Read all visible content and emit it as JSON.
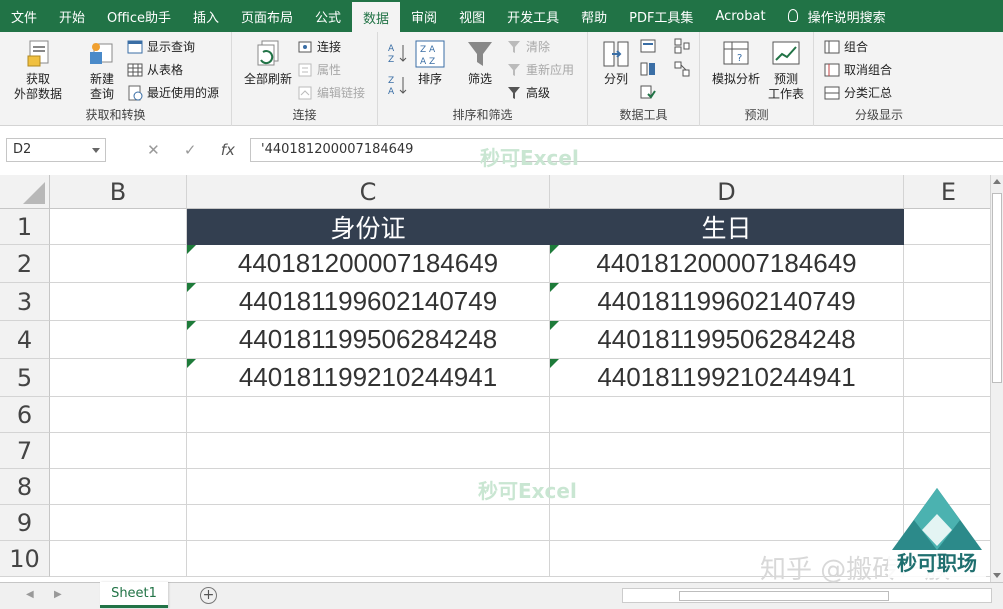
{
  "menu": {
    "tabs": [
      "文件",
      "开始",
      "Office助手",
      "插入",
      "页面布局",
      "公式",
      "数据",
      "审阅",
      "视图",
      "开发工具",
      "帮助",
      "PDF工具集",
      "Acrobat"
    ],
    "active_tab": "数据",
    "tell_me": "操作说明搜索"
  },
  "ribbon": {
    "get_transform": {
      "label": "获取和转换",
      "get_external_data": "获取\n外部数据",
      "new_query": "新建\n查询",
      "show_queries": "显示查询",
      "from_table": "从表格",
      "recent_sources": "最近使用的源"
    },
    "connections": {
      "label": "连接",
      "refresh_all": "全部刷新",
      "connections": "连接",
      "properties": "属性",
      "edit_links": "编辑链接"
    },
    "sort_filter": {
      "label": "排序和筛选",
      "sort": "排序",
      "filter": "筛选",
      "clear": "清除",
      "reapply": "重新应用",
      "advanced": "高级"
    },
    "data_tools": {
      "label": "数据工具",
      "text_to_columns": "分列"
    },
    "forecast": {
      "label": "预测",
      "what_if": "模拟分析",
      "forecast_sheet": "预测\n工作表"
    },
    "outline": {
      "label": "分级显示",
      "group": "组合",
      "ungroup": "取消组合",
      "subtotal": "分类汇总"
    }
  },
  "formula_bar": {
    "name_box": "D2",
    "formula": "'440181200007184649",
    "fx": "fx"
  },
  "grid": {
    "columns": [
      "B",
      "C",
      "D",
      "E"
    ],
    "rows": [
      "1",
      "2",
      "3",
      "4",
      "5",
      "6",
      "7",
      "8",
      "9",
      "10"
    ],
    "header_c": "身份证",
    "header_d": "生日",
    "col_c": [
      "440181200007184649",
      "440181199602140749",
      "440181199506284248",
      "440181199210244941"
    ],
    "col_d": [
      "440181200007184649",
      "440181199602140749",
      "440181199506284248",
      "440181199210244941"
    ]
  },
  "watermark": "秒可Excel",
  "sheets": {
    "active": "Sheet1"
  },
  "overlay": {
    "zhihu": "知乎 @搬砖一族",
    "logo_text": "秒可职场"
  },
  "colors": {
    "accent": "#217346",
    "header_fill": "#333f50"
  }
}
